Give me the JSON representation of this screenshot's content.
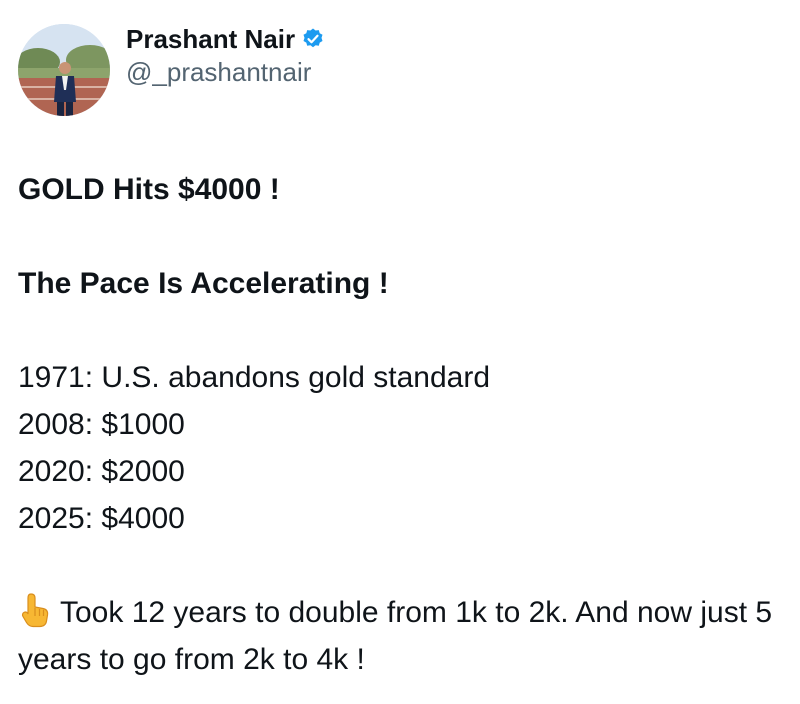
{
  "author": {
    "display_name": "Prashant Nair",
    "handle": "@_prashantnair",
    "verified_icon": "verified-badge-icon",
    "verified_color": "#1d9bf0"
  },
  "tweet": {
    "headline": "GOLD Hits $4000 !",
    "subheadline": "The Pace Is Accelerating !",
    "timeline": [
      "1971: U.S. abandons gold standard",
      "2008: $1000",
      "2020: $2000",
      "2025: $4000"
    ],
    "closing_icon": "pointing-up-emoji-icon",
    "closing_text": "Took 12 years to double from 1k to 2k. And now just 5 years to go from 2k to 4k !"
  }
}
